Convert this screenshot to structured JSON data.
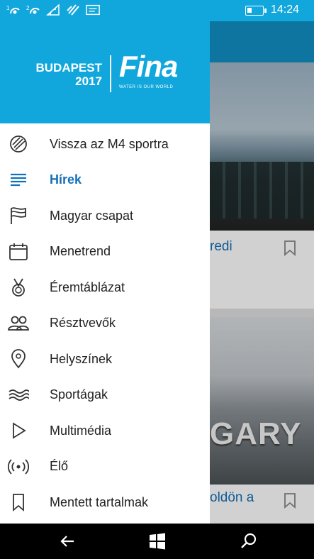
{
  "status_bar": {
    "icons": [
      "sim1-signal-icon",
      "sim2-signal-icon",
      "wifi-icon",
      "data-icon",
      "message-icon"
    ],
    "sim1_label": "1",
    "sim2_label": "2",
    "battery_icon": "battery-icon",
    "time": "14:24"
  },
  "drawer": {
    "logo": {
      "line1": "BUDAPEST",
      "line2": "2017",
      "brand": "Fina",
      "tagline": "WATER IS OUR WORLD"
    },
    "items": [
      {
        "label": "Vissza az M4 sportra",
        "icon": "m4-sport-icon",
        "active": false
      },
      {
        "label": "Hírek",
        "icon": "news-icon",
        "active": true
      },
      {
        "label": "Magyar csapat",
        "icon": "flag-icon",
        "active": false
      },
      {
        "label": "Menetrend",
        "icon": "calendar-icon",
        "active": false
      },
      {
        "label": "Éremtáblázat",
        "icon": "medal-icon",
        "active": false
      },
      {
        "label": "Résztvevők",
        "icon": "people-icon",
        "active": false
      },
      {
        "label": "Helyszínek",
        "icon": "location-icon",
        "active": false
      },
      {
        "label": "Sportágak",
        "icon": "water-waves-icon",
        "active": false
      },
      {
        "label": "Multimédia",
        "icon": "play-icon",
        "active": false
      },
      {
        "label": "Élő",
        "icon": "live-broadcast-icon",
        "active": false
      },
      {
        "label": "Mentett tartalmak",
        "icon": "bookmark-icon",
        "active": false
      }
    ]
  },
  "background": {
    "card1_title": "redi",
    "card2_title": "oldön a",
    "image2_sign": "GARY"
  },
  "navbar": {
    "back": "back-arrow-icon",
    "home": "windows-icon",
    "search": "search-icon"
  },
  "colors": {
    "accent": "#12a7dc",
    "active_text": "#1470b8"
  }
}
